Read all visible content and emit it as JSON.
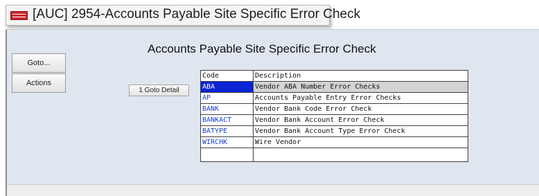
{
  "window": {
    "title": "[AUC] 2954-Accounts Payable Site Specific Error Check",
    "app_icon": "app-logo-icon"
  },
  "sidebar": {
    "goto_label": "Goto...",
    "actions_label": "Actions"
  },
  "main": {
    "heading": "Accounts Payable Site Specific Error Check",
    "goto_detail_label": "1 Goto Detail"
  },
  "grid": {
    "columns": [
      "Code",
      "Description"
    ],
    "rows": [
      {
        "code": "ABA",
        "description": "Vendor ABA Number Error Checks",
        "selected": true
      },
      {
        "code": "AP",
        "description": "Accounts Payable Entry Error Checks",
        "selected": false
      },
      {
        "code": "BANK",
        "description": "Vendor Bank Code Error Check",
        "selected": false
      },
      {
        "code": "BANKACT",
        "description": "Vendor Bank Account Error Check",
        "selected": false
      },
      {
        "code": "BATYPE",
        "description": "Vendor Bank Account Type Error Check",
        "selected": false
      },
      {
        "code": "WIRCHK",
        "description": "Wire Vendor",
        "selected": false
      }
    ]
  },
  "colors": {
    "window_bg": "#dfe6ef",
    "selected_code_bg": "#0a24d6",
    "code_text": "#1a3fcf"
  }
}
